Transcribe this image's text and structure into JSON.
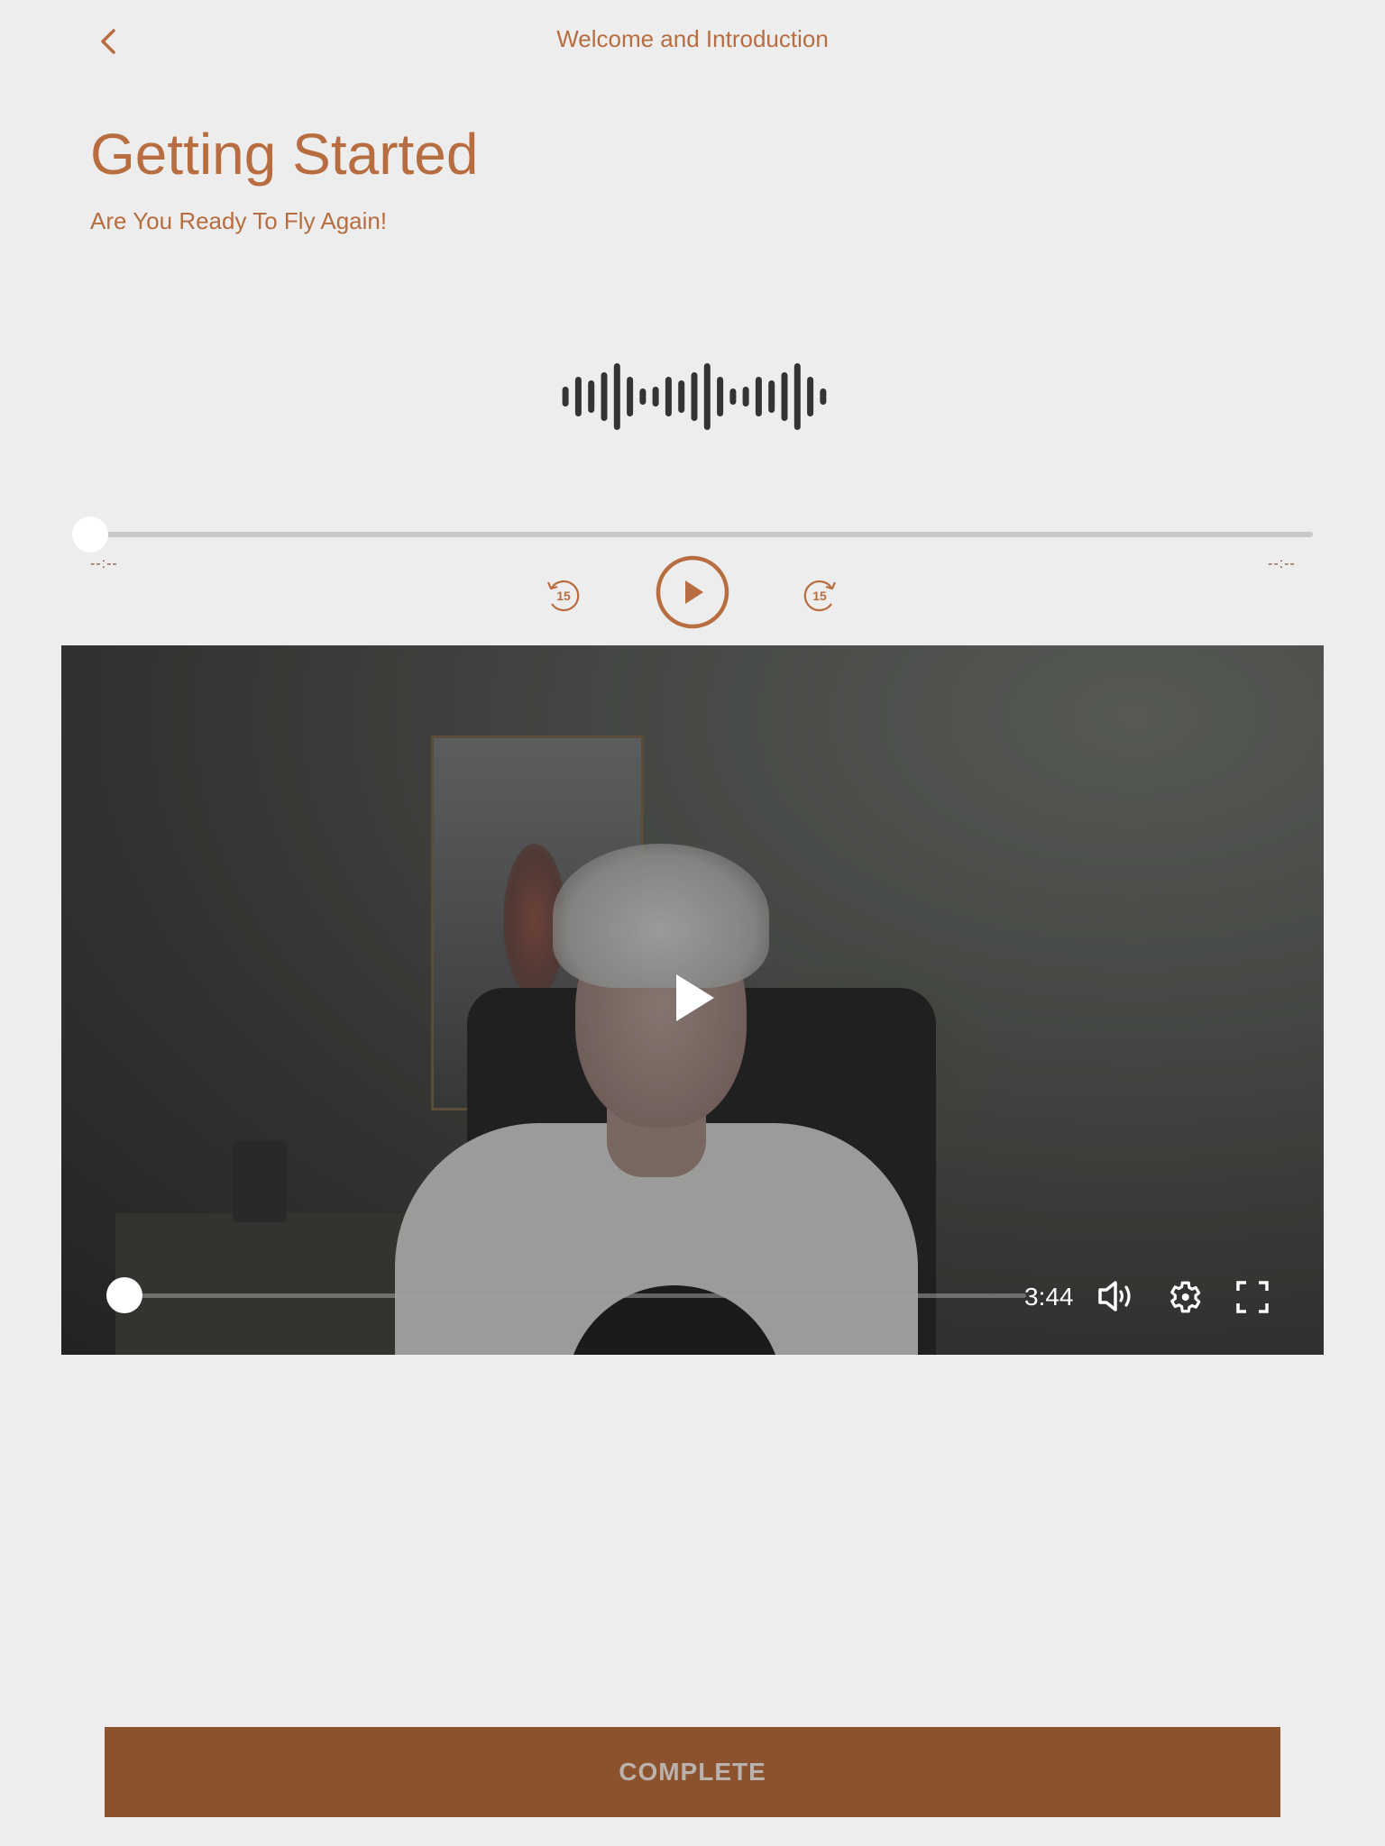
{
  "header": {
    "title": "Welcome and Introduction",
    "back_icon": "chevron-left-icon"
  },
  "lesson": {
    "title": "Getting Started",
    "subtitle": "Are You Ready To Fly Again!"
  },
  "audio_player": {
    "waveform_icon": "audio-waveform-icon",
    "elapsed": "--:--",
    "total": "--:--",
    "progress": 0,
    "rewind_label": "15",
    "forward_label": "15",
    "rewind_icon": "rewind-15-icon",
    "play_icon": "play-circle-icon",
    "forward_icon": "forward-15-icon"
  },
  "video_player": {
    "duration": "3:44",
    "progress": 0,
    "play_icon": "play-icon",
    "volume_icon": "volume-icon",
    "settings_icon": "gear-icon",
    "fullscreen_icon": "fullscreen-icon"
  },
  "footer": {
    "complete_label": "COMPLETE"
  },
  "colors": {
    "accent": "#b86d40",
    "button_bg": "#8c522e",
    "button_text": "#b9b2ad",
    "background": "#ededed"
  }
}
